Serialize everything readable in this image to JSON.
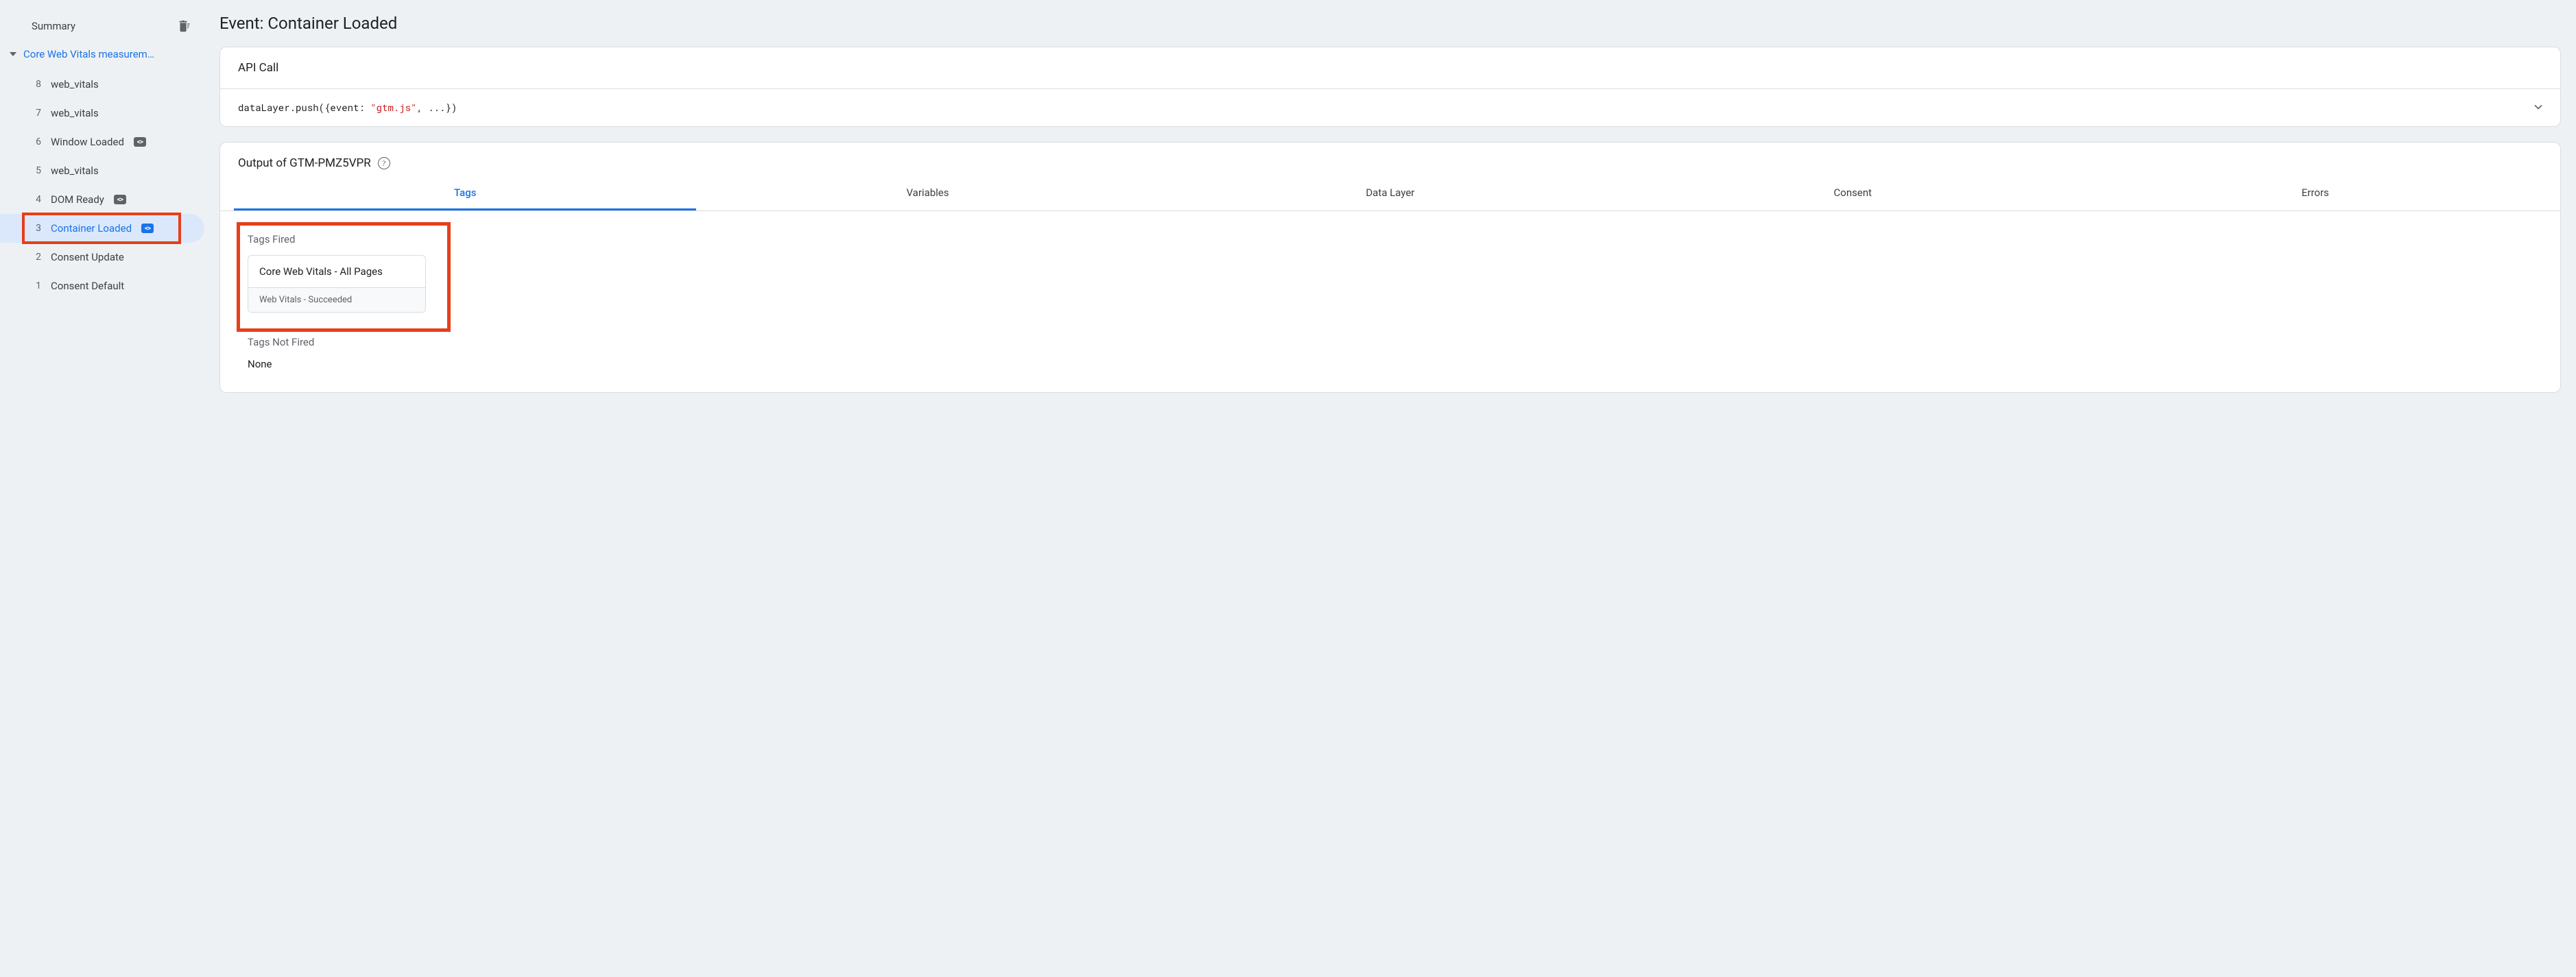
{
  "sidebar": {
    "summary_label": "Summary",
    "group_label": "Core Web Vitals measurem…",
    "events": [
      {
        "idx": "8",
        "label": "web_vitals",
        "has_badge": false,
        "active": false,
        "highlighted": false
      },
      {
        "idx": "7",
        "label": "web_vitals",
        "has_badge": false,
        "active": false,
        "highlighted": false
      },
      {
        "idx": "6",
        "label": "Window Loaded",
        "has_badge": true,
        "active": false,
        "highlighted": false
      },
      {
        "idx": "5",
        "label": "web_vitals",
        "has_badge": false,
        "active": false,
        "highlighted": false
      },
      {
        "idx": "4",
        "label": "DOM Ready",
        "has_badge": true,
        "active": false,
        "highlighted": false
      },
      {
        "idx": "3",
        "label": "Container Loaded",
        "has_badge": true,
        "active": true,
        "highlighted": true
      },
      {
        "idx": "2",
        "label": "Consent Update",
        "has_badge": false,
        "active": false,
        "highlighted": false
      },
      {
        "idx": "1",
        "label": "Consent Default",
        "has_badge": false,
        "active": false,
        "highlighted": false
      }
    ]
  },
  "page_title": "Event: Container Loaded",
  "api_card": {
    "title": "API Call",
    "code_prefix": "dataLayer.push({event: ",
    "code_string": "\"gtm.js\"",
    "code_suffix": ", ...})"
  },
  "output_card": {
    "title": "Output of GTM-PMZ5VPR",
    "tabs": [
      "Tags",
      "Variables",
      "Data Layer",
      "Consent",
      "Errors"
    ],
    "active_tab_index": 0,
    "fired_label": "Tags Fired",
    "fired_tags": [
      {
        "name": "Core Web Vitals - All Pages",
        "status": "Web Vitals - Succeeded"
      }
    ],
    "not_fired_label": "Tags Not Fired",
    "not_fired_value": "None"
  }
}
